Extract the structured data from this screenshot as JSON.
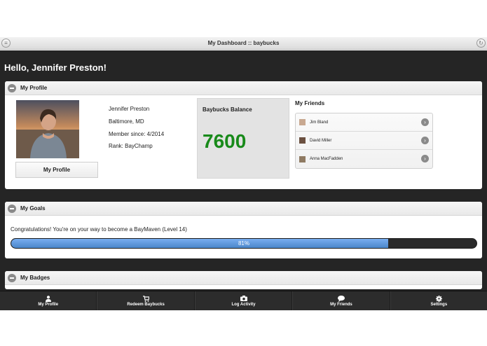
{
  "titlebar": {
    "title": "My Dashboard :: baybucks"
  },
  "greeting": "Hello, Jennifer Preston!",
  "profile": {
    "section_title": "My Profile",
    "name": "Jennifer Preston",
    "location": "Baltimore, MD",
    "member_since": "Member since: 4/2014",
    "rank": "Rank: BayChamp",
    "button_label": "My Profile"
  },
  "balance": {
    "label": "Baybucks Balance",
    "value": "7600",
    "value_color": "#188a1a"
  },
  "friends": {
    "title": "My Friends",
    "items": [
      {
        "name": "Jim Bland"
      },
      {
        "name": "David Miller"
      },
      {
        "name": "Anna MacFadden"
      }
    ]
  },
  "goals": {
    "section_title": "My Goals",
    "message": "Congratulations! You're on your way to become a BayMaven (Level 14)",
    "progress_label": "81%",
    "progress_fraction": 0.81
  },
  "badges": {
    "section_title": "My Badges"
  },
  "nav": {
    "items": [
      {
        "label": "My Profile",
        "icon": "user-icon"
      },
      {
        "label": "Redeem Baybucks",
        "icon": "cart-icon"
      },
      {
        "label": "Log Activity",
        "icon": "camera-icon"
      },
      {
        "label": "My Friends",
        "icon": "chat-icon"
      },
      {
        "label": "Settings",
        "icon": "gear-icon"
      }
    ]
  }
}
